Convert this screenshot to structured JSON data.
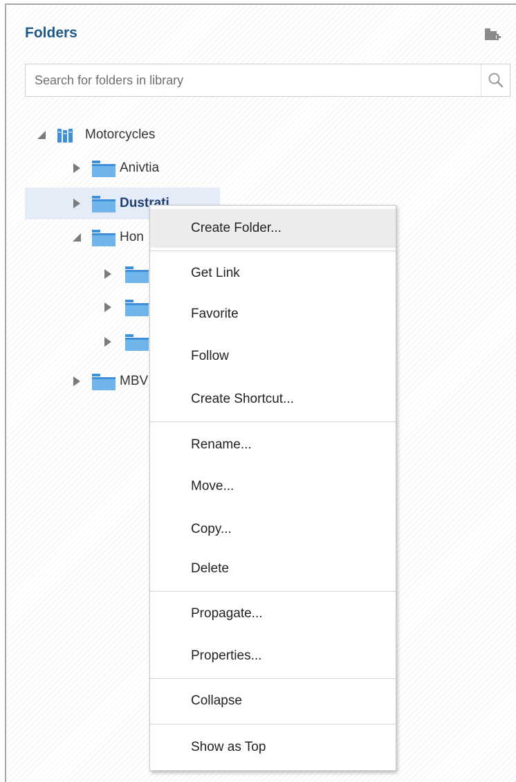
{
  "panel": {
    "title": "Folders",
    "new_folder_icon": "new-folder-icon"
  },
  "search": {
    "placeholder": "Search for folders in library",
    "value": "",
    "icon": "search-icon"
  },
  "tree": {
    "root": {
      "label": "Motorcycles",
      "expanded": true,
      "icon": "library-icon"
    },
    "items": [
      {
        "label": "Anivtia",
        "expanded": false,
        "selected": false
      },
      {
        "label": "Dustrati",
        "expanded": false,
        "selected": true
      },
      {
        "label": "Hon",
        "expanded": true,
        "selected": false
      },
      {
        "label": "",
        "expanded": false,
        "selected": false
      },
      {
        "label": "",
        "expanded": false,
        "selected": false
      },
      {
        "label": "",
        "expanded": false,
        "selected": false
      },
      {
        "label": "MBV",
        "expanded": false,
        "selected": false
      }
    ]
  },
  "context_menu": {
    "items": [
      {
        "label": "Create Folder...",
        "hovered": true
      },
      {
        "label": "Get Link"
      },
      {
        "label": "Favorite"
      },
      {
        "label": "Follow"
      },
      {
        "label": "Create Shortcut..."
      },
      {
        "label": "Rename..."
      },
      {
        "label": "Move..."
      },
      {
        "label": "Copy..."
      },
      {
        "label": "Delete"
      },
      {
        "label": "Propagate..."
      },
      {
        "label": "Properties..."
      },
      {
        "label": "Collapse"
      },
      {
        "label": "Show as Top"
      }
    ]
  },
  "colors": {
    "title": "#1f5a8c",
    "folder_fill": "#6fb4ea",
    "folder_tab": "#3c8fd8",
    "selected_row": "#e4ecf8",
    "menu_hover": "#ececec"
  }
}
